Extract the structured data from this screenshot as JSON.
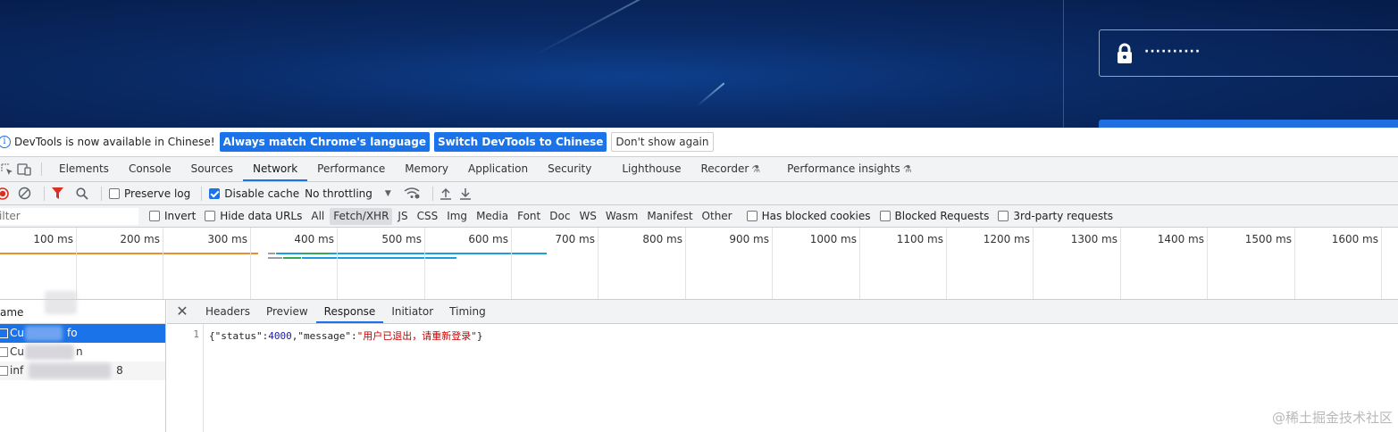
{
  "page": {
    "password_mask": "··········",
    "icons": {
      "lock": "lock-icon"
    }
  },
  "infobar": {
    "message": "DevTools is now available in Chinese!",
    "btn_match": "Always match Chrome's language",
    "btn_switch": "Switch DevTools to Chinese",
    "btn_dismiss": "Don't show again"
  },
  "tabs": [
    "Elements",
    "Console",
    "Sources",
    "Network",
    "Performance",
    "Memory",
    "Application",
    "Security",
    "Lighthouse",
    "Recorder",
    "Performance insights"
  ],
  "active_tab": "Network",
  "toolbar": {
    "preserve_log": "Preserve log",
    "disable_cache": "Disable cache",
    "throttling": "No throttling"
  },
  "filter": {
    "placeholder": "Filter",
    "invert": "Invert",
    "hide_data_urls": "Hide data URLs",
    "types": [
      "All",
      "Fetch/XHR",
      "JS",
      "CSS",
      "Img",
      "Media",
      "Font",
      "Doc",
      "WS",
      "Wasm",
      "Manifest",
      "Other"
    ],
    "active_type": "Fetch/XHR",
    "has_blocked_cookies": "Has blocked cookies",
    "blocked_requests": "Blocked Requests",
    "third_party": "3rd-party requests"
  },
  "overview": {
    "ticks": [
      "100 ms",
      "200 ms",
      "300 ms",
      "400 ms",
      "500 ms",
      "600 ms",
      "700 ms",
      "800 ms",
      "900 ms",
      "1000 ms",
      "1100 ms",
      "1200 ms",
      "1300 ms",
      "1400 ms",
      "1500 ms",
      "1600 ms"
    ]
  },
  "requests": {
    "header": "ame",
    "rows": [
      {
        "prefix": "Cu",
        "suffix": "fo"
      },
      {
        "prefix": "Cu",
        "suffix": "n"
      },
      {
        "prefix": "inf",
        "suffix": "8"
      }
    ]
  },
  "detail": {
    "tabs": [
      "Headers",
      "Preview",
      "Response",
      "Initiator",
      "Timing"
    ],
    "active_tab": "Response",
    "line_no": "1",
    "response": {
      "p1": "{\"status\":",
      "status_value": "4000",
      "p2": ",\"message\":",
      "message_value": "\"用户已退出，请重新登录\"",
      "p3": "}"
    }
  },
  "watermark": "@稀土掘金技术社区",
  "colors": {
    "accent": "#1a73e8",
    "record_red": "#d93025"
  }
}
